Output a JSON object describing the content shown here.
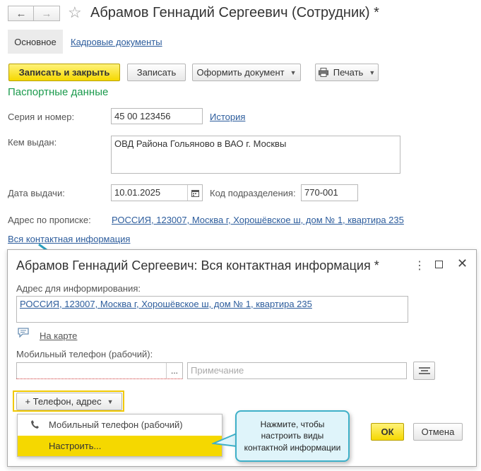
{
  "window": {
    "title": "Абрамов Геннадий Сергеевич (Сотрудник) *",
    "back_icon": "←",
    "forward_icon": "→",
    "favorite_icon": "☆"
  },
  "tabs": [
    {
      "label": "Основное"
    },
    {
      "label": "Кадровые документы"
    }
  ],
  "toolbar": {
    "save_close_label": "Записать и закрыть",
    "save_label": "Записать",
    "create_document_label": "Оформить документ",
    "print_label": "Печать"
  },
  "passport": {
    "section_title": "Паспортные данные",
    "series_label": "Серия и номер:",
    "series_value": "45 00 123456",
    "history_link": "История",
    "issued_by_label": "Кем выдан:",
    "issued_by_value": "ОВД Района Гольяново в ВАО г. Москвы",
    "issue_date_label": "Дата выдачи:",
    "issue_date_value": "10.01.2025",
    "department_code_label": "Код подразделения:",
    "department_code_value": "770-001",
    "registration_label": "Адрес по прописке:",
    "registration_value": "РОССИЯ, 123007, Москва г, Хорошёвское ш, дом № 1, квартира 235",
    "all_contact_link": "Вся контактная информация"
  },
  "dialog": {
    "title": "Абрамов Геннадий Сергеевич: Вся контактная информация *",
    "info_address_label": "Адрес для информирования:",
    "info_address_value": "РОССИЯ, 123007, Москва г, Хорошёвское ш, дом № 1, квартира 235",
    "map_link": "На карте",
    "mobile_label": "Мобильный телефон (рабочий):",
    "mobile_value": "",
    "ellipsis_label": "...",
    "note_placeholder": "Примечание",
    "add_button_label": "+ Телефон, адрес",
    "ok_label": "ОК",
    "cancel_label": "Отмена",
    "dropdown_items": [
      {
        "label": "Мобильный телефон (рабочий)"
      },
      {
        "label": "Настроить..."
      }
    ]
  },
  "callout": {
    "text": "Нажмите, чтобы настроить виды контактной информации"
  },
  "colors": {
    "accent_yellow": "#f5d800",
    "section_green": "#1a9a4c",
    "link_blue": "#2c5c9c",
    "callout_border": "#3fb0c8"
  }
}
